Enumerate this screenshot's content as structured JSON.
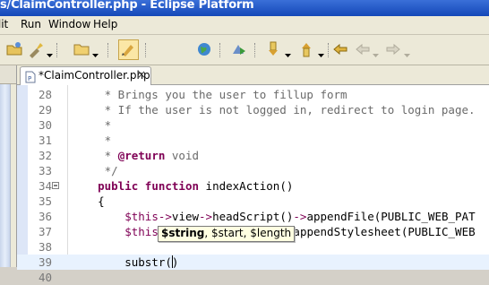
{
  "window": {
    "title": "s/ClaimController.php - Eclipse Platform"
  },
  "menu": [
    "Edit",
    "Run",
    "Window",
    "Help"
  ],
  "editor_tab": {
    "label": "*ClaimController.php",
    "close_glyph": "×"
  },
  "code_lines": [
    {
      "num": "28",
      "segments": [
        {
          "t": "     * Brings you the user to fillup form",
          "c": "c-com"
        }
      ]
    },
    {
      "num": "29",
      "segments": [
        {
          "t": "     * If the user is not logged in, redirect to login page.",
          "c": "c-com"
        }
      ]
    },
    {
      "num": "30",
      "segments": [
        {
          "t": "     *",
          "c": "c-com"
        }
      ]
    },
    {
      "num": "31",
      "segments": [
        {
          "t": "     *",
          "c": "c-com"
        }
      ]
    },
    {
      "num": "32",
      "segments": [
        {
          "t": "     * ",
          "c": "c-com"
        },
        {
          "t": "@return",
          "c": "c-tag"
        },
        {
          "t": " void",
          "c": "c-com"
        }
      ]
    },
    {
      "num": "33",
      "segments": [
        {
          "t": "     */",
          "c": "c-com"
        }
      ]
    },
    {
      "num": "34",
      "fold": true,
      "segments": [
        {
          "t": "    ",
          "c": ""
        },
        {
          "t": "public",
          "c": "c-kw"
        },
        {
          "t": " ",
          "c": ""
        },
        {
          "t": "function",
          "c": "c-kw"
        },
        {
          "t": " indexAction()",
          "c": ""
        }
      ]
    },
    {
      "num": "35",
      "segments": [
        {
          "t": "    {",
          "c": ""
        }
      ]
    },
    {
      "num": "36",
      "segments": [
        {
          "t": "        ",
          "c": ""
        },
        {
          "t": "$this",
          "c": "c-var"
        },
        {
          "t": "->",
          "c": "c-arr"
        },
        {
          "t": "view",
          "c": ""
        },
        {
          "t": "->",
          "c": "c-arr"
        },
        {
          "t": "headScript()",
          "c": ""
        },
        {
          "t": "->",
          "c": "c-arr"
        },
        {
          "t": "appendFile(PUBLIC_WEB_PAT",
          "c": ""
        }
      ]
    },
    {
      "num": "37",
      "segments": [
        {
          "t": "        ",
          "c": ""
        },
        {
          "t": "$this",
          "c": "c-var"
        },
        {
          "t": "->",
          "c": "c-arr"
        },
        {
          "t": "view",
          "c": ""
        },
        {
          "t": "->",
          "c": "c-arr"
        },
        {
          "t": "headLink()",
          "c": ""
        },
        {
          "t": "->",
          "c": "c-arr"
        },
        {
          "t": "appendStylesheet(PUBLIC_WEB",
          "c": ""
        }
      ]
    },
    {
      "num": "38",
      "segments": [
        {
          "t": "",
          "c": ""
        }
      ]
    },
    {
      "num": "39",
      "current": true,
      "segments": [
        {
          "t": "        substr(",
          "c": ""
        },
        {
          "t": "|cursor|",
          "c": "cursor"
        },
        {
          "t": ")",
          "c": ""
        }
      ]
    },
    {
      "num": "40",
      "segments": [
        {
          "t": "",
          "c": ""
        }
      ]
    }
  ],
  "param_hint": {
    "bold": "$string",
    "rest": ", $start, $length"
  },
  "toolbar_icons": [
    "open-folder-icon",
    "build-icon",
    "new-folder-icon",
    "highlight-icon",
    "globe-icon",
    "run-icon",
    "next-annotation-icon",
    "previous-annotation-icon",
    "last-edit-icon",
    "back-icon",
    "forward-icon"
  ],
  "colors": {
    "keyword": "#7f0055",
    "comment": "#6a6a6a",
    "current_line": "#e8f2fe",
    "title_bar": "#1448b8"
  }
}
